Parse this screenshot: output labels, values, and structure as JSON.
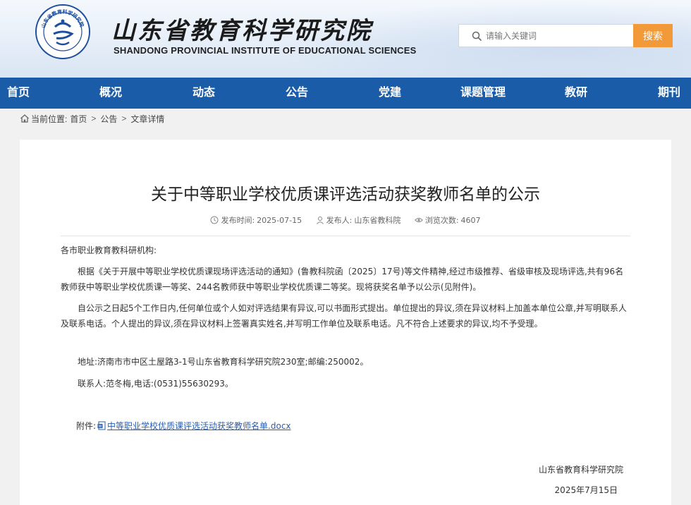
{
  "header": {
    "title_cn": "山东省教育科学研究院",
    "title_en": "SHANDONG PROVINCIAL INSTITUTE OF EDUCATIONAL SCIENCES",
    "logo_text": "山东省教育科学研究院"
  },
  "search": {
    "placeholder": "请输入关键词",
    "button_label": "搜索"
  },
  "nav": {
    "items": [
      "首页",
      "概况",
      "动态",
      "公告",
      "党建",
      "课题管理",
      "教研",
      "期刊"
    ]
  },
  "breadcrumb": {
    "prefix": "当前位置:",
    "items": [
      "首页",
      "公告",
      "文章详情"
    ],
    "separator": ">"
  },
  "article": {
    "title": "关于中等职业学校优质课评选活动获奖教师名单的公示",
    "publish_time_label": "发布时间:",
    "publish_time": "2025-07-15",
    "publisher_label": "发布人:",
    "publisher": "山东省教科院",
    "views_label": "浏览次数:",
    "views": "4607",
    "salutation": "各市职业教育教科研机构:",
    "paragraphs": [
      "根据《关于开展中等职业学校优质课现场评选活动的通知》(鲁教科院函〔2025〕17号)等文件精神,经过市级推荐、省级审核及现场评选,共有96名教师获中等职业学校优质课一等奖、244名教师获中等职业学校优质课二等奖。现将获奖名单予以公示(见附件)。",
      "自公示之日起5个工作日内,任何单位或个人如对评选结果有异议,可以书面形式提出。单位提出的异议,须在异议材料上加盖本单位公章,并写明联系人及联系电话。个人提出的异议,须在异议材料上签署真实姓名,并写明工作单位及联系电话。凡不符合上述要求的异议,均不予受理。",
      "地址:济南市市中区土屋路3-1号山东省教育科学研究院230室;邮编:250002。",
      "联系人:范冬梅,电话:(0531)55630293。"
    ],
    "attachment_label": "附件:",
    "attachment_name": "中等职业学校优质课评选活动获奖教师名单.docx",
    "sign_org": "山东省教育科学研究院",
    "sign_date": "2025年7月15日"
  },
  "colors": {
    "nav_bg": "#1a5ca8",
    "search_button": "#f29a3a",
    "link": "#2a5db0",
    "logo_blue": "#1d4f9e"
  },
  "icons": [
    "search-icon",
    "home-icon",
    "clock-icon",
    "user-icon",
    "eye-icon",
    "doc-icon"
  ]
}
